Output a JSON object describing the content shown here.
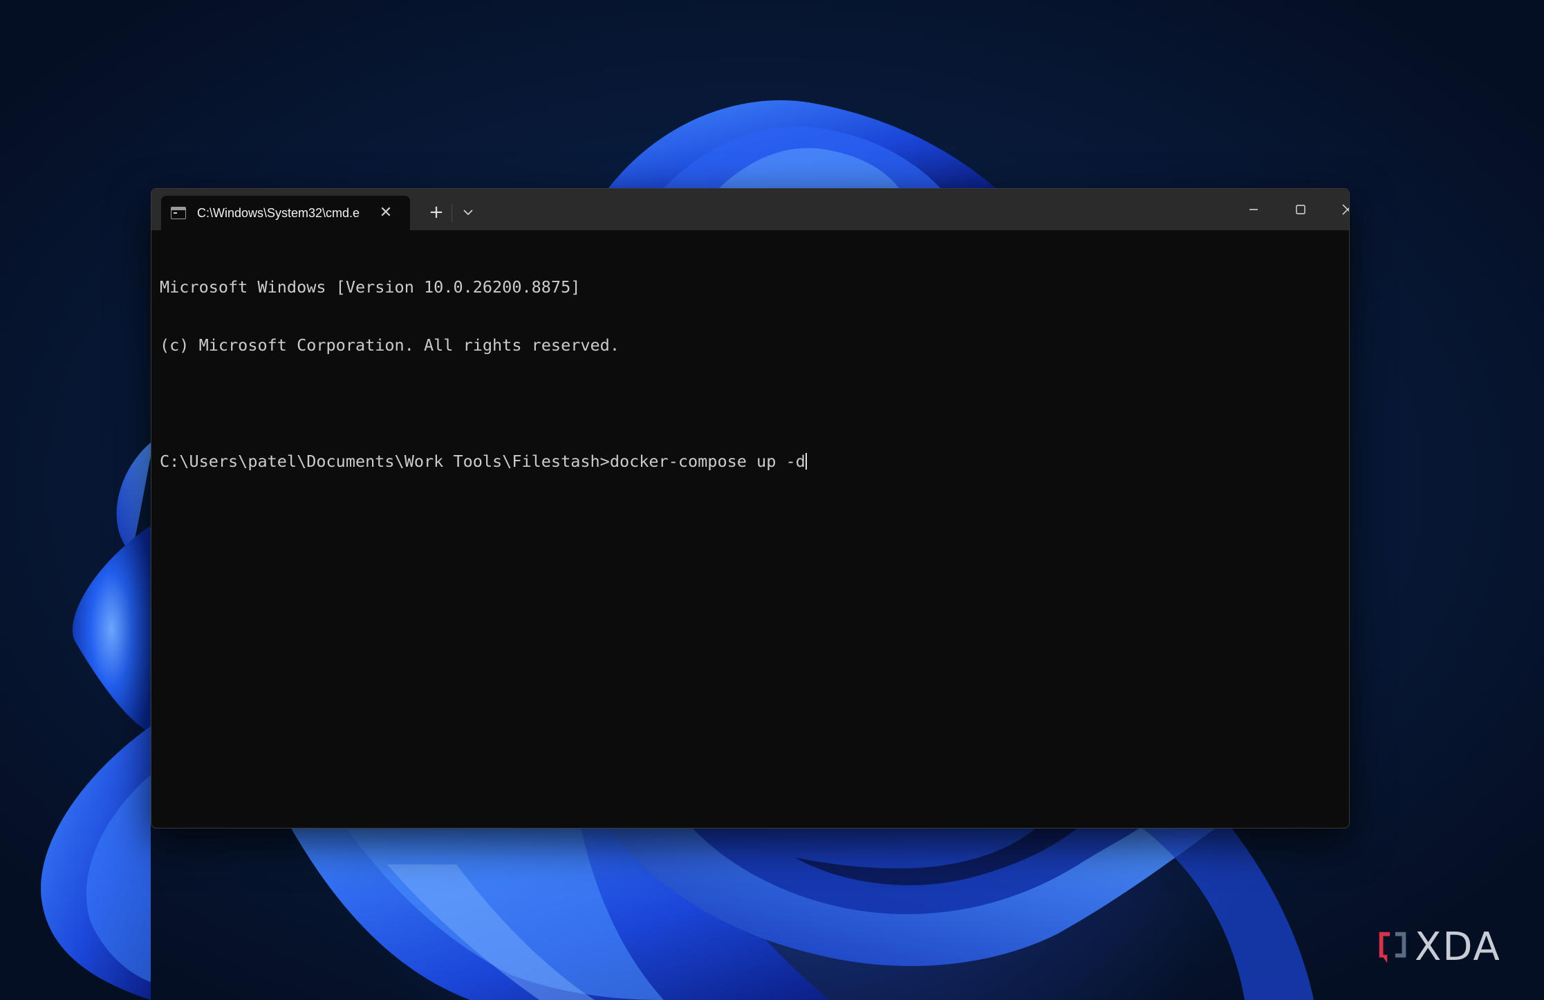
{
  "window": {
    "tab_title": "C:\\Windows\\System32\\cmd.e",
    "new_tab_label": "+",
    "tab_close_label": "✕"
  },
  "console": {
    "lines": [
      "Microsoft Windows [Version 10.0.26200.8875]",
      "(c) Microsoft Corporation. All rights reserved.",
      "",
      "C:\\Users\\patel\\Documents\\Work Tools\\Filestash>docker-compose up -d"
    ]
  },
  "watermark": {
    "text": "XDA"
  },
  "colors": {
    "terminal_bg": "#0c0c0c",
    "titlebar_bg": "#2b2b2b",
    "terminal_text": "#cccccc",
    "wallpaper_accent": "#1f4fe0"
  },
  "icons": {
    "tab": "terminal-icon",
    "dropdown": "chevron-down-icon",
    "minimize": "minimize-icon",
    "maximize": "maximize-icon",
    "close": "close-icon",
    "watermark": "xda-logo-icon"
  }
}
